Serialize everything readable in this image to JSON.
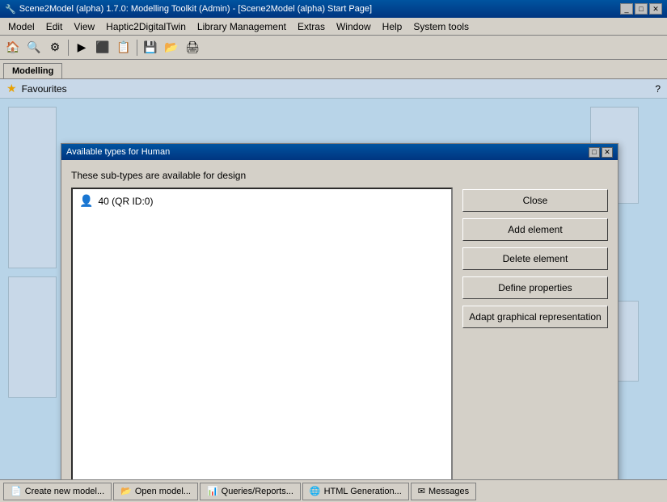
{
  "window": {
    "title": "Scene2Model (alpha) 1.7.0: Modelling Toolkit (Admin) - [Scene2Model (alpha) Start Page]",
    "controls": [
      "_",
      "□",
      "✕"
    ]
  },
  "menubar": {
    "items": [
      "Model",
      "Edit",
      "View",
      "Haptic2DigitalTwin",
      "Library Management",
      "Extras",
      "Window",
      "Help",
      "System tools"
    ]
  },
  "tabs": {
    "active": "Modelling",
    "items": [
      "Modelling"
    ]
  },
  "favourites": {
    "label": "Favourites"
  },
  "modal": {
    "title": "Available types for Human",
    "subtitle": "These sub-types are available for design",
    "list_items": [
      {
        "icon": "👤",
        "label": "40 (QR ID:0)"
      }
    ],
    "buttons": {
      "close": "Close",
      "add_element": "Add element",
      "delete_element": "Delete element",
      "define_properties": "Define properties",
      "adapt_graphical": "Adapt graphical representation"
    }
  },
  "statusbar": {
    "items": [
      {
        "icon": "📄",
        "label": "Create new model..."
      },
      {
        "icon": "📂",
        "label": "Open model..."
      },
      {
        "icon": "📊",
        "label": "Queries/Reports..."
      },
      {
        "icon": "🌐",
        "label": "HTML Generation..."
      },
      {
        "icon": "✉",
        "label": "Messages"
      }
    ]
  },
  "icons": {
    "star": "★",
    "help": "?",
    "arrow_right": "▶",
    "resize": "◢",
    "person": "👤"
  }
}
